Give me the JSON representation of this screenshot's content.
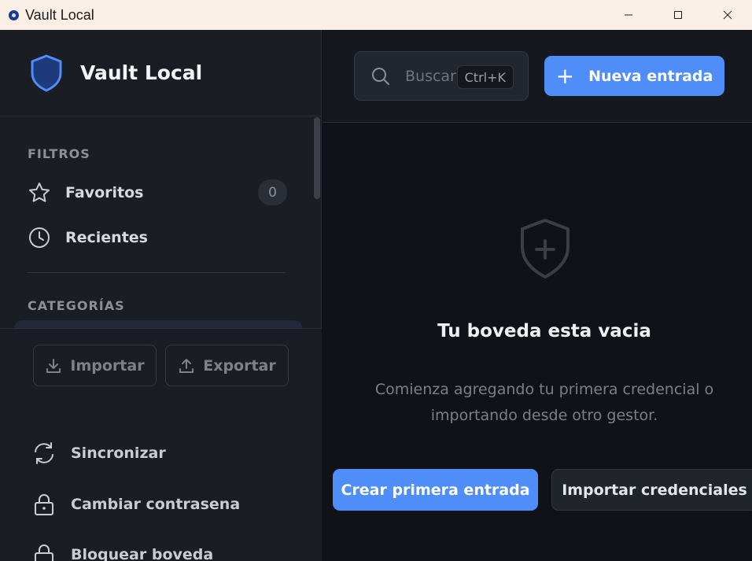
{
  "window": {
    "title": "Vault Local"
  },
  "sidebar": {
    "brand": "Vault Local",
    "filters_label": "FILTROS",
    "favorites_label": "Favoritos",
    "favorites_count": "0",
    "recent_label": "Recientes",
    "categories_label": "CATEGORÍAS",
    "import_label": "Importar",
    "export_label": "Exportar",
    "sync_label": "Sincronizar",
    "change_password_label": "Cambiar contrasena",
    "lock_label": "Bloquear boveda"
  },
  "header": {
    "search_placeholder": "Buscar",
    "search_shortcut": "Ctrl+K",
    "new_entry_label": "Nueva entrada"
  },
  "empty_state": {
    "title": "Tu boveda esta vacia",
    "description": "Comienza agregando tu primera credencial o importando desde otro gestor.",
    "primary_action": "Crear primera entrada",
    "secondary_action": "Importar credenciales"
  },
  "colors": {
    "accent": "#4f8df9",
    "sidebar_bg": "#1a1d24",
    "main_bg": "#101217"
  }
}
